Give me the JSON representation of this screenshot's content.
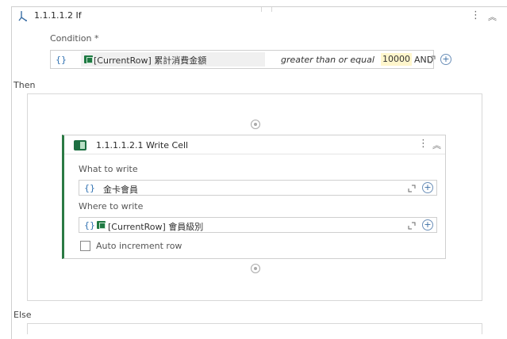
{
  "if_block": {
    "title": "1.1.1.1.2 If",
    "condition_label": "Condition *",
    "condition": {
      "braces": "{}",
      "variable": "[CurrentRow] 累計消費金額",
      "operator": "greater than or equal",
      "value": "10000",
      "conjunction": "AND"
    },
    "then_label": "Then",
    "else_label": "Else"
  },
  "write_cell": {
    "title": "1.1.1.1.2.1 Write Cell",
    "what_label": "What to write",
    "what_value": "金卡會員",
    "where_label": "Where to write",
    "where_value": "[CurrentRow] 會員級別",
    "auto_increment_label": "Auto increment row",
    "auto_increment_checked": false
  },
  "icons": {
    "if_icon": "branch-icon",
    "menu": "kebab-menu-icon",
    "collapse": "double-chevron-up-icon",
    "expand": "expand-icon",
    "add": "plus-circle-icon",
    "excel": "excel-icon"
  },
  "glyphs": {
    "kebab": "⋮",
    "chevron": "︽",
    "plus": "+",
    "braces": "{}"
  },
  "colors": {
    "accent": "#2b7a44",
    "link_blue": "#2d6fb0",
    "value_highlight": "#fff6cc"
  }
}
